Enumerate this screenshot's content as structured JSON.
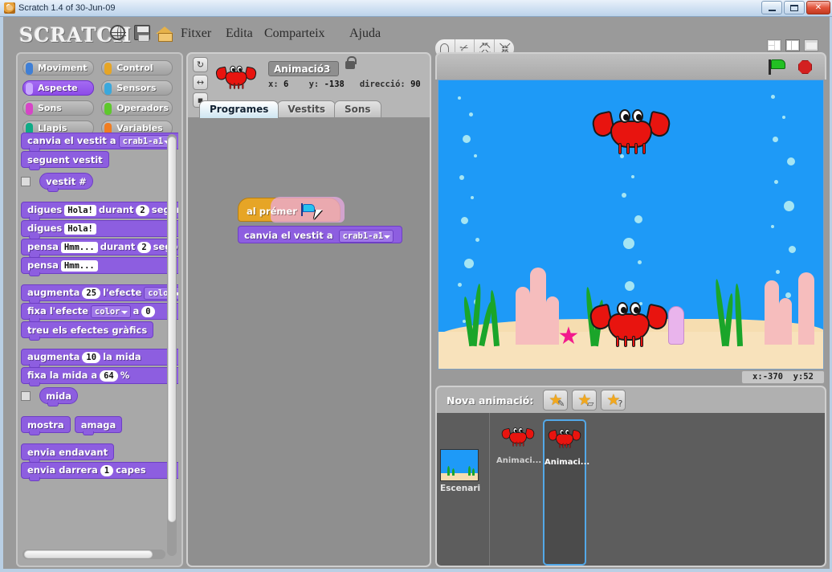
{
  "window": {
    "title": "Scratch 1.4 of 30-Jun-09",
    "icon": "scratch-cat-icon",
    "buttons": {
      "minimize": "minimize-icon",
      "maximize": "maximize-icon",
      "close": "✕"
    }
  },
  "toolbar": {
    "logo": "SCRATCH",
    "icons": [
      "globe-icon",
      "save-icon",
      "home-icon"
    ],
    "menu": [
      "Fitxer",
      "Edita",
      "Comparteix",
      "Ajuda"
    ],
    "tools": [
      "stamp-icon",
      "scissors-icon",
      "grow-icon",
      "shrink-icon"
    ],
    "layout_buttons": [
      "small-stage-layout",
      "normal-stage-layout",
      "presentation-mode"
    ]
  },
  "palette": {
    "categories": [
      {
        "label": "Moviment",
        "color": "#3f7fd6",
        "selected": false
      },
      {
        "label": "Control",
        "color": "#e6a526",
        "selected": false
      },
      {
        "label": "Aspecte",
        "color": "#8d5ee0",
        "selected": true
      },
      {
        "label": "Sensors",
        "color": "#3aa8dd",
        "selected": false
      },
      {
        "label": "Sons",
        "color": "#d645c7",
        "selected": false
      },
      {
        "label": "Operadors",
        "color": "#5ec82c",
        "selected": false
      },
      {
        "label": "Llapis",
        "color": "#0fab86",
        "selected": false
      },
      {
        "label": "Variables",
        "color": "#f07d21",
        "selected": false
      }
    ],
    "blocks": [
      {
        "id": "canvia-vestit",
        "parts": [
          "canvia el vestit a"
        ],
        "dropdown": "crab1-a1"
      },
      {
        "id": "seguent-vestit",
        "parts": [
          "seguent vestit"
        ]
      },
      {
        "id": "vestit-num",
        "parts": [
          "vestit #"
        ],
        "checkbox": true
      },
      {
        "id": "digues-durant",
        "parts": [
          "digues",
          "durant",
          "segons"
        ],
        "field1": "Hola!",
        "field2": "2"
      },
      {
        "id": "digues",
        "parts": [
          "digues"
        ],
        "field1": "Hola!"
      },
      {
        "id": "pensa-durant",
        "parts": [
          "pensa",
          "durant",
          "segons"
        ],
        "field1": "Hmm...",
        "field2": "2"
      },
      {
        "id": "pensa",
        "parts": [
          "pensa"
        ],
        "field1": "Hmm..."
      },
      {
        "id": "augmenta-efecte",
        "parts": [
          "augmenta",
          "l'efecte"
        ],
        "field1": "25",
        "dropdown": "color"
      },
      {
        "id": "fixa-efecte",
        "parts": [
          "fixa l'efecte",
          "a"
        ],
        "dropdown": "color",
        "field1": "0"
      },
      {
        "id": "treu-efectes",
        "parts": [
          "treu els efectes gràfics"
        ]
      },
      {
        "id": "augmenta-mida",
        "parts": [
          "augmenta",
          "la mida"
        ],
        "field1": "10"
      },
      {
        "id": "fixa-mida",
        "parts": [
          "fixa la mida a",
          "%"
        ],
        "field1": "64"
      },
      {
        "id": "mida",
        "parts": [
          "mida"
        ],
        "checkbox": true
      },
      {
        "id": "mostra",
        "parts": [
          "mostra"
        ]
      },
      {
        "id": "amaga",
        "parts": [
          "amaga"
        ]
      },
      {
        "id": "envia-endavant",
        "parts": [
          "envia endavant"
        ]
      },
      {
        "id": "envia-darrera",
        "parts": [
          "envia darrera",
          "capes"
        ],
        "field1": "1"
      }
    ]
  },
  "sprite_header": {
    "name": "Animació3",
    "x_label": "x:",
    "x_value": "6",
    "y_label": "y:",
    "y_value": "-138",
    "dir_label": "direcció:",
    "dir_value": "90",
    "rotation_buttons": [
      "rotate-freely-icon",
      "left-right-flip-icon",
      "no-rotate-icon"
    ],
    "lock": "lock-icon",
    "tabs": [
      {
        "label": "Programes",
        "active": true
      },
      {
        "label": "Vestits",
        "active": false
      },
      {
        "label": "Sons",
        "active": false
      }
    ]
  },
  "script": {
    "hat_label": "al prémer",
    "hat_icon": "green-flag-icon",
    "command_label": "canvia el vestit a",
    "command_dropdown": "crab1-a1",
    "cursor": "mouse-pointer"
  },
  "stage": {
    "green_flag": "green-flag-icon",
    "stop": "stop-icon",
    "mouse_x_label": "x:",
    "mouse_x": "-370",
    "mouse_y_label": "y:",
    "mouse_y": "52",
    "background_color": "#1e9af7",
    "sand_color": "#f6ddb0"
  },
  "corral": {
    "new_label": "Nova animació:",
    "buttons": [
      "paint-new-sprite-icon",
      "import-sprite-icon",
      "surprise-sprite-icon"
    ],
    "stage_label": "Escenari",
    "sprites": [
      {
        "name": "Animaci...",
        "selected": false
      },
      {
        "name": "Animaci...",
        "selected": true
      }
    ]
  }
}
